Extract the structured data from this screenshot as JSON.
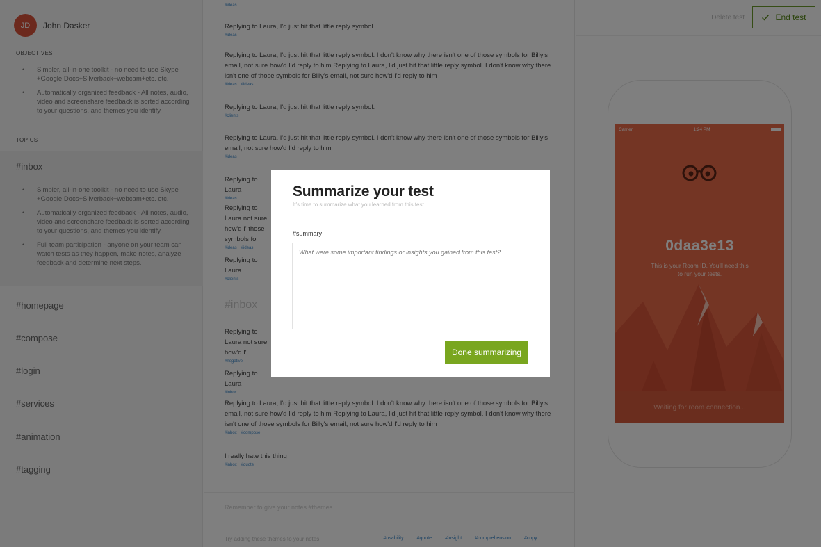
{
  "sidebar": {
    "avatar_initials": "JD",
    "user_name": "John Dasker",
    "objectives_heading": "OBJECTIVES",
    "objectives": [
      "Simpler, all-in-one toolkit - no need to use Skype +Google Docs+Silverback+webcam+etc. etc.",
      "Automatically organized feedback - All notes, audio, video and screenshare feedback is sorted according to your questions, and themes you identify."
    ],
    "topics_heading": "TOPICS",
    "inbox_topic": "#inbox",
    "inbox_bullets": [
      "Simpler, all-in-one toolkit - no need to use Skype +Google Docs+Silverback+webcam+etc. etc.",
      "Automatically organized feedback - All notes, audio, video and screenshare feedback is sorted according to your questions, and themes you identify.",
      "Full team participation - anyone on your team can watch tests as they happen, make notes, analyze feedback and determine next steps."
    ],
    "topics": [
      "#homepage",
      "#compose",
      "#login",
      "#services",
      "#animation",
      "#tagging"
    ]
  },
  "feed": {
    "entries": [
      {
        "text": "Replying to Laura, I'd just hit that little reply symbol.",
        "tags": [
          "#ideas"
        ]
      },
      {
        "text": "Replying to Laura, I'd just hit that little reply symbol. I don't know why there isn't one of those symbols for Billy's email, not sure how'd I'd reply to him Replying to Laura, I'd just hit that little reply symbol. I don't know why there isn't one of those symbols for Billy's email, not sure how'd I'd reply to him",
        "tags": [
          "#ideas",
          "#ideas"
        ]
      },
      {
        "text": "Replying to Laura, I'd just hit that little reply symbol.",
        "tags": [
          "#clients"
        ]
      },
      {
        "text": "Replying to Laura, I'd just hit that little reply symbol. I don't know why there isn't one of those symbols for Billy's email, not sure how'd I'd reply to him",
        "tags": [
          "#ideas"
        ]
      },
      {
        "text": "Replying to Laura",
        "tags": [
          "#ideas"
        ]
      },
      {
        "text": "Replying to Laura not sure how'd I' those symbols fo",
        "tags": [
          "#ideas",
          "#ideas"
        ]
      },
      {
        "text": "Replying to Laura",
        "tags": [
          "#clients"
        ]
      },
      {
        "text": "Replying to Laura not sure how'd I'",
        "tags": [
          "#negative"
        ]
      },
      {
        "text": "Replying to Laura",
        "tags": [
          "#inbox"
        ]
      },
      {
        "text": "Replying to Laura, I'd just hit that little reply symbol. I don't know why there isn't one of those symbols for Billy's email, not sure how'd I'd reply to him Replying to Laura, I'd just hit that little reply symbol. I don't know why there isn't one of those symbols for Billy's email, not sure how'd I'd reply to him",
        "tags": [
          "#inbox",
          "#compose"
        ]
      },
      {
        "text": "I really hate this thing",
        "tags": [
          "#inbox",
          "#quote"
        ]
      }
    ],
    "heading": "#inbox",
    "top_tag": "#ideas",
    "input_placeholder": "Remember to give your notes #themes",
    "footer_hint": "Try adding these themes to your notes:",
    "footer_tags": [
      "#usability",
      "#quote",
      "#insight",
      "#comprehension",
      "#copy"
    ]
  },
  "right": {
    "delete_label": "Delete test",
    "end_label": "End test",
    "phone": {
      "carrier": "Carrier",
      "time": "1:24 PM",
      "room_id": "0daa3e13",
      "room_note": "This is your Room ID. You'll need this to run your tests.",
      "waiting": "Waiting for room connection..."
    }
  },
  "modal": {
    "title": "Summarize your test",
    "subtitle": "It's time to summarize what you learned from this test",
    "label": "#summary",
    "placeholder": "What were some important findings or insights you gained from this test?",
    "button": "Done summarizing"
  }
}
